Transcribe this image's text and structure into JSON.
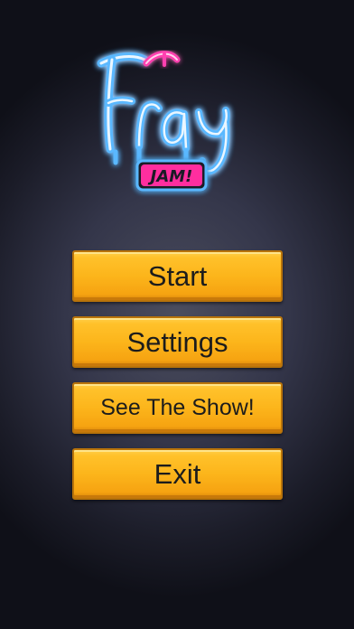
{
  "logo": {
    "title": "Fray",
    "badge": "JAM!",
    "colors": {
      "neon_blue": "#5ab8ff",
      "neon_core": "#ffffff",
      "neon_pink": "#ff3fb0",
      "badge_fill": "#ff2e9f"
    }
  },
  "menu": {
    "start_label": "Start",
    "settings_label": "Settings",
    "show_label": "See The Show!",
    "exit_label": "Exit"
  },
  "theme": {
    "button_color": "#fcb51b",
    "background": "#2b2d3c"
  }
}
